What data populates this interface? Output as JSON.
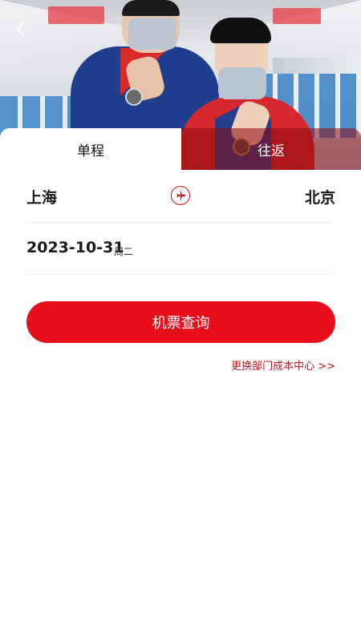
{
  "header": {
    "back_icon": "chevron-left-icon"
  },
  "tabs": [
    {
      "label": "单程",
      "active": true
    },
    {
      "label": "往返",
      "active": false
    }
  ],
  "route": {
    "from": "上海",
    "to": "北京",
    "swap_icon": "airplane-swap-icon"
  },
  "date": {
    "value": "2023-10-31",
    "weekday": "周二"
  },
  "search": {
    "button_label": "机票查询"
  },
  "cost_center": {
    "link_label": "更换部门成本中心 >>"
  },
  "colors": {
    "accent": "#e50e1a",
    "link": "#c0141d",
    "inactive_tab": "#8c0a0e"
  }
}
